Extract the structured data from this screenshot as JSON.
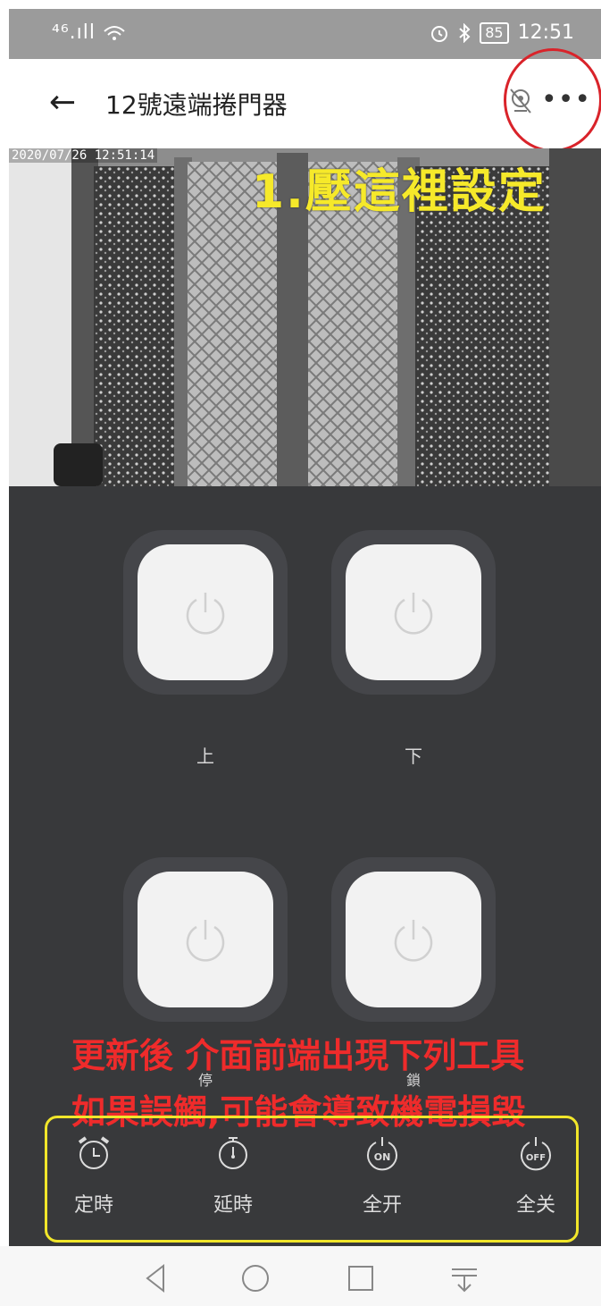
{
  "status_bar": {
    "signal": "⁴⁶.ıll",
    "battery": "85",
    "time": "12:51"
  },
  "header": {
    "title": "12號遠端捲門器"
  },
  "video": {
    "timestamp": "2020/07/26 12:51:14"
  },
  "annotations": {
    "step1": "1.壓這裡設定",
    "note1": "更新後 介面前端出現下列工具",
    "note2": "如果誤觸,可能會導致機電損毀"
  },
  "controls": [
    {
      "label": "上"
    },
    {
      "label": "下"
    },
    {
      "label": "停"
    },
    {
      "label": "鎖"
    }
  ],
  "tools": [
    {
      "label": "定時",
      "icon": "alarm-clock-icon"
    },
    {
      "label": "延時",
      "icon": "stopwatch-icon"
    },
    {
      "label": "全开",
      "icon": "power-on-icon",
      "badge": "ON"
    },
    {
      "label": "全关",
      "icon": "power-off-icon",
      "badge": "OFF"
    }
  ],
  "colors": {
    "panel": "#38393b",
    "annotation_red": "#ef2b2b",
    "annotation_yellow": "#f6e92a"
  }
}
